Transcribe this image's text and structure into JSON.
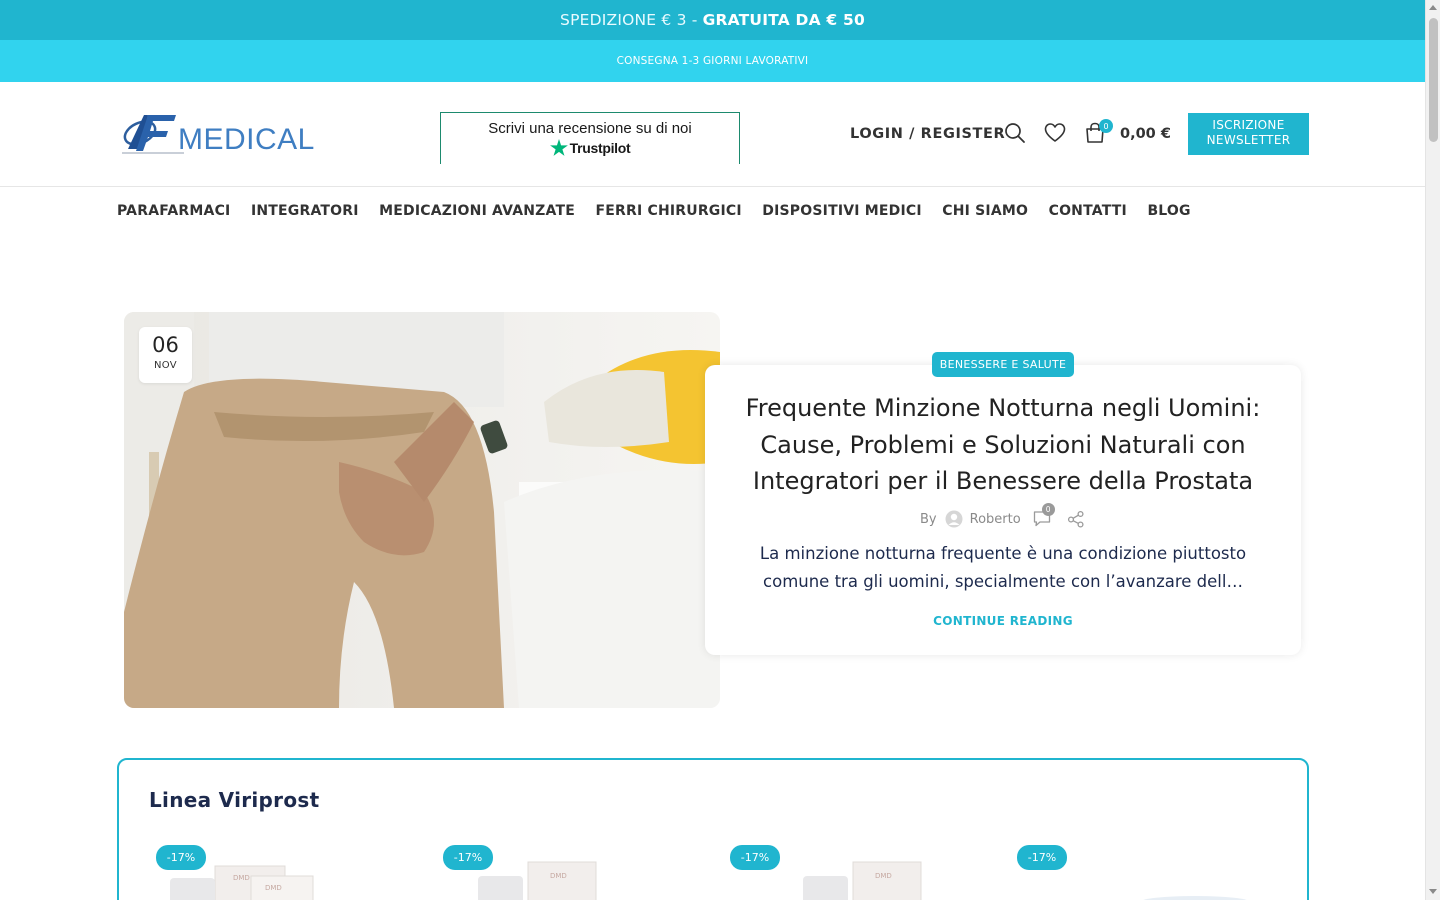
{
  "topbar": {
    "shipping_text": "SPEDIZIONE € 3 -",
    "shipping_free": "GRATUITA DA € 50",
    "delivery_text": "CONSEGNA 1-3 GIORNI LAVORATIVI"
  },
  "header": {
    "logo_text": "MEDICAL",
    "trustpilot_text": "Scrivi una recensione su di noi",
    "trustpilot_brand": "Trustpilot",
    "login_label": "LOGIN / REGISTER",
    "cart_count": "0",
    "cart_total": "0,00 €",
    "newsletter_line1": "ISCRIZIONE",
    "newsletter_line2": "NEWSLETTER",
    "icons": [
      "search-icon",
      "heart-icon",
      "cart-icon"
    ],
    "accent_color": "#20b5cf"
  },
  "nav": {
    "items": [
      "PARAFARMACI",
      "INTEGRATORI",
      "MEDICAZIONI AVANZATE",
      "FERRI CHIRURGICI",
      "DISPOSITIVI MEDICI",
      "CHI SIAMO",
      "CONTATTI",
      "BLOG"
    ]
  },
  "post": {
    "date_day": "06",
    "date_month": "NOV",
    "category": "BENESSERE E SALUTE",
    "title": "Frequente Minzione Notturna negli Uomini: Cause, Problemi e Soluzioni Naturali con Integratori per il Benessere della Prostata",
    "by": "By",
    "author": "Roberto",
    "comments": "0",
    "excerpt": "La minzione notturna frequente è una condizione piuttosto comune tra gli uomini, specialmente con l’avanzare dell…",
    "continue_label": "CONTINUE READING"
  },
  "viriprost": {
    "title": "Linea Viriprost",
    "products": [
      {
        "discount": "-17%"
      },
      {
        "discount": "-17%"
      },
      {
        "discount": "-17%"
      },
      {
        "discount": "-17%"
      }
    ]
  }
}
